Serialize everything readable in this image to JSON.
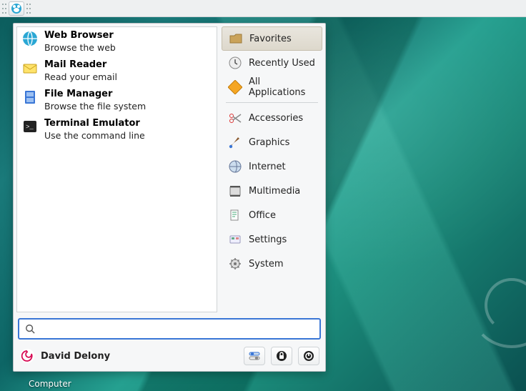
{
  "panel": {
    "launcher_icon": "xfce-mouse-icon"
  },
  "desktop": {
    "icon_label": "Computer"
  },
  "menu": {
    "favorites": [
      {
        "icon": "globe-icon",
        "title": "Web Browser",
        "subtitle": "Browse the web"
      },
      {
        "icon": "mail-icon",
        "title": "Mail Reader",
        "subtitle": "Read your email"
      },
      {
        "icon": "cabinet-icon",
        "title": "File Manager",
        "subtitle": "Browse the file system"
      },
      {
        "icon": "terminal-icon",
        "title": "Terminal Emulator",
        "subtitle": "Use the command line"
      }
    ],
    "categories_top": [
      {
        "icon": "star-folder-icon",
        "label": "Favorites",
        "active": true
      },
      {
        "icon": "clock-icon",
        "label": "Recently Used",
        "active": false
      },
      {
        "icon": "apps-icon",
        "label": "All Applications",
        "active": false
      }
    ],
    "categories": [
      {
        "icon": "scissors-icon",
        "label": "Accessories"
      },
      {
        "icon": "brush-icon",
        "label": "Graphics"
      },
      {
        "icon": "internet-icon",
        "label": "Internet"
      },
      {
        "icon": "multimedia-icon",
        "label": "Multimedia"
      },
      {
        "icon": "office-icon",
        "label": "Office"
      },
      {
        "icon": "settings-icon",
        "label": "Settings"
      },
      {
        "icon": "system-icon",
        "label": "System"
      }
    ],
    "search_placeholder": "",
    "user_name": "David Delony",
    "user_icon": "debian-swirl-icon",
    "action_buttons": [
      {
        "name": "settings-button",
        "icon": "toggle-icon"
      },
      {
        "name": "lock-button",
        "icon": "lock-icon"
      },
      {
        "name": "power-button",
        "icon": "power-icon"
      }
    ]
  }
}
